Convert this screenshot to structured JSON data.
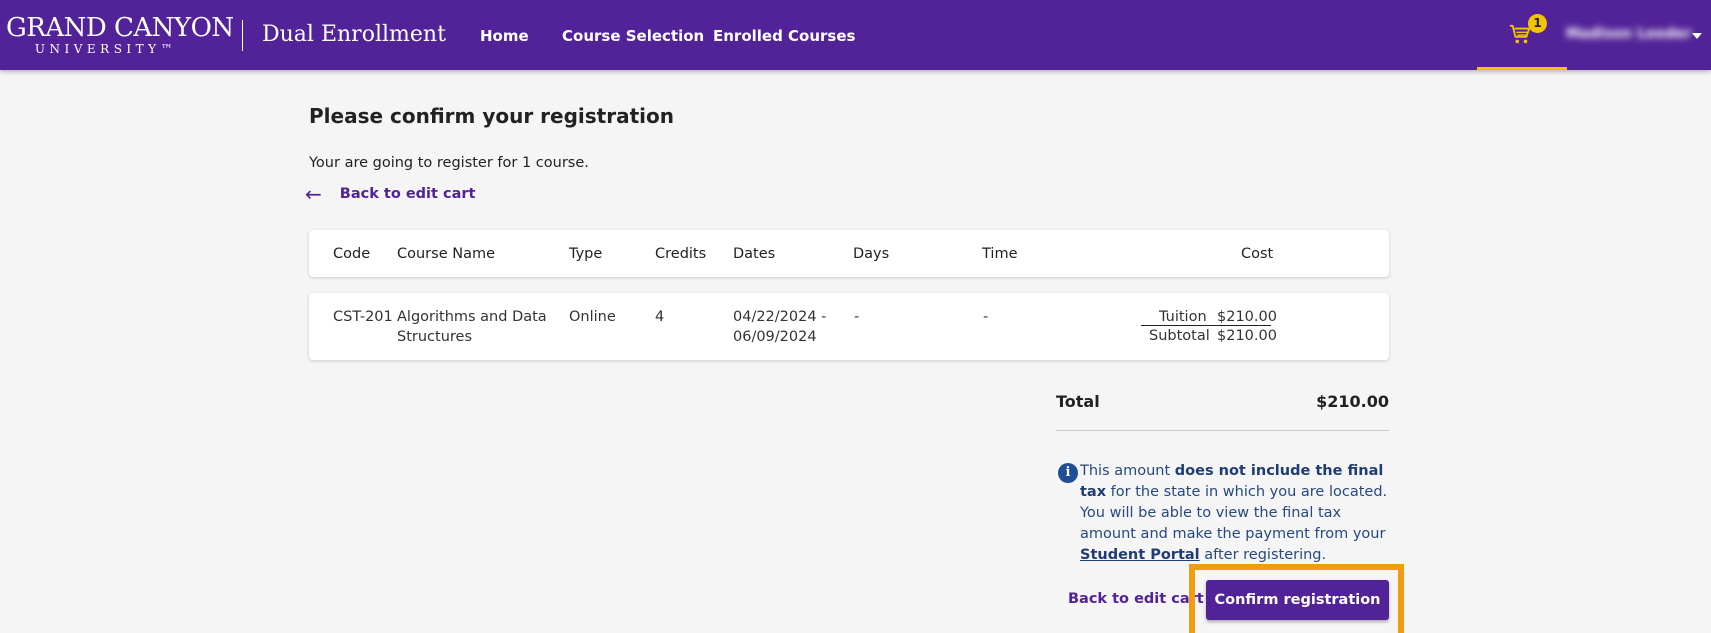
{
  "header": {
    "logo_main": "GRAND CANYON",
    "logo_sub": "UNIVERSITY™",
    "product": "Dual Enrollment",
    "nav": [
      "Home",
      "Course Selection",
      "Enrolled Courses"
    ],
    "cart_count": "1",
    "user_name": "Madison Leeder",
    "colors": {
      "bar": "#522398",
      "accent": "#f5c400"
    }
  },
  "page": {
    "title": "Please confirm your registration",
    "intro": "Your are going to register for 1 course.",
    "back_link": "Back to edit cart"
  },
  "table": {
    "headers": [
      "Code",
      "Course Name",
      "Type",
      "Credits",
      "Dates",
      "Days",
      "Time",
      "Cost"
    ],
    "rows": [
      {
        "code": "CST-201",
        "name_line1": "Algorithms and Data",
        "name_line2": "Structures",
        "type": "Online",
        "credits": "4",
        "dates_line1": "04/22/2024 -",
        "dates_line2": "06/09/2024",
        "days": "-",
        "time": "-",
        "tuition_label": "Tuition",
        "tuition_value": "$210.00",
        "subtotal_label": "Subtotal",
        "subtotal_value": "$210.00"
      }
    ]
  },
  "summary": {
    "total_label": "Total",
    "total_value": "$210.00",
    "info_pre": "This amount ",
    "info_bold": "does not include the final tax",
    "info_mid": " for the state in which you are located. You will be able to view the final tax amount and make the payment from your ",
    "info_link": "Student Portal",
    "info_post": " after registering.",
    "back_link": "Back to edit cart",
    "confirm_label": "Confirm registration"
  }
}
